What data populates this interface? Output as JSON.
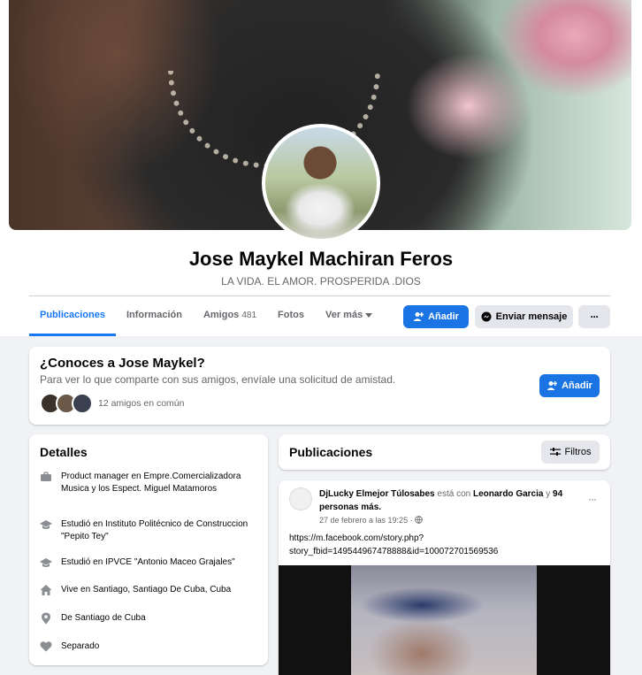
{
  "profile": {
    "name": "Jose Maykel Machiran Feros",
    "bio": "LA VIDA. EL AMOR. PROSPERIDA .DIOS"
  },
  "tabs": [
    {
      "label": "Publicaciones"
    },
    {
      "label": "Información"
    },
    {
      "label": "Amigos",
      "count": "481"
    },
    {
      "label": "Fotos"
    },
    {
      "label": "Ver más"
    }
  ],
  "actions": {
    "add_label": "Añadir",
    "message_label": "Enviar mensaje",
    "more_label": "···"
  },
  "know_card": {
    "title": "¿Conoces a Jose Maykel?",
    "subtitle": "Para ver lo que comparte con sus amigos, envíale una solicitud de amistad.",
    "mutual": "12 amigos en común",
    "add_label": "Añadir"
  },
  "details": {
    "title": "Detalles",
    "items": [
      {
        "icon": "briefcase-icon",
        "text": "Product manager en Empre.Comercializadora Musica y los Espect. Miguel Matamoros"
      },
      {
        "icon": "graduation-cap-icon",
        "text": "Estudió en Instituto Politécnico de Construccion \"Pepito Tey\""
      },
      {
        "icon": "graduation-cap-icon",
        "text": "Estudió en IPVCE \"Antonio Maceo Grajales\""
      },
      {
        "icon": "home-icon",
        "text": "Vive en Santiago, Santiago De Cuba, Cuba"
      },
      {
        "icon": "location-pin-icon",
        "text": "De Santiago de Cuba"
      },
      {
        "icon": "heart-icon",
        "text": "Separado"
      }
    ]
  },
  "posts": {
    "title": "Publicaciones",
    "filters_label": "Filtros",
    "post": {
      "author": "DjLucky Elmejor Túlosabes",
      "with_text": "está con",
      "tagged": "Leonardo Garcia",
      "and_text": "y",
      "others": "94 personas más.",
      "date": "27 de febrero a las 19:25 ·",
      "more_label": "···",
      "link": "https://m.facebook.com/story.php?story_fbid=149544967478888&id=100072701569536"
    }
  },
  "colors": {
    "accent": "#1877f2",
    "button_blue": "#1b74e4",
    "background": "#f0f2f5",
    "secondary_text": "#65676b"
  }
}
